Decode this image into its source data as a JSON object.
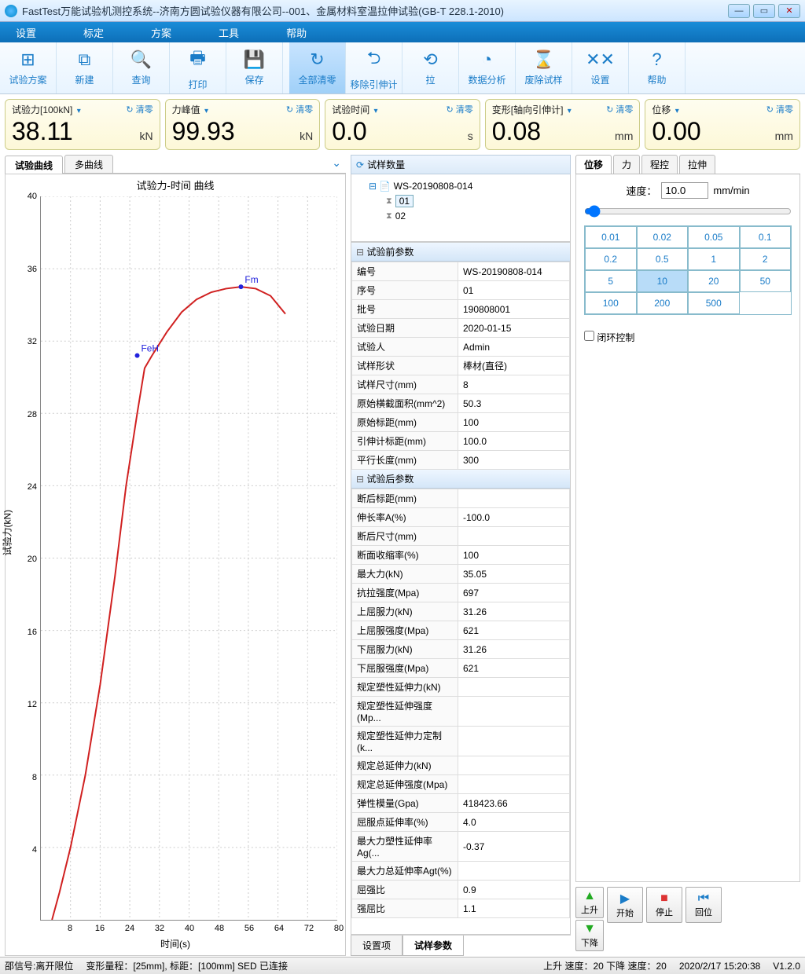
{
  "window": {
    "title": "FastTest万能试验机测控系统--济南方圆试验仪器有限公司--001、金属材料室温拉伸试验(GB-T 228.1-2010)"
  },
  "menu": {
    "items": [
      "设置",
      "标定",
      "方案",
      "工具",
      "帮助"
    ]
  },
  "toolbar": {
    "items": [
      {
        "label": "试验方案",
        "icon": "⊞"
      },
      {
        "label": "新建",
        "icon": "⧉"
      },
      {
        "label": "查询",
        "icon": "🔍"
      },
      {
        "label": "打印",
        "icon": "🖶"
      },
      {
        "label": "保存",
        "icon": "💾"
      },
      {
        "label": "全部清零",
        "icon": "↻",
        "active": true
      },
      {
        "label": "移除引伸计",
        "icon": "⮌"
      },
      {
        "label": "拉",
        "icon": "⟲"
      },
      {
        "label": "数据分析",
        "icon": "◔"
      },
      {
        "label": "废除试样",
        "icon": "⌛"
      },
      {
        "label": "设置",
        "icon": "✕✕"
      },
      {
        "label": "帮助",
        "icon": "?"
      }
    ]
  },
  "readouts": [
    {
      "label": "试验力[100kN]",
      "value": "38.11",
      "unit": "kN",
      "zero": "清零"
    },
    {
      "label": "力峰值",
      "value": "99.93",
      "unit": "kN",
      "zero": "清零"
    },
    {
      "label": "试验时间",
      "value": "0.0",
      "unit": "s",
      "zero": "清零"
    },
    {
      "label": "变形[轴向引伸计]",
      "value": "0.08",
      "unit": "mm",
      "zero": "清零"
    },
    {
      "label": "位移",
      "value": "0.00",
      "unit": "mm",
      "zero": "清零"
    }
  ],
  "curve_tabs": {
    "items": [
      "试验曲线",
      "多曲线"
    ],
    "active": 0
  },
  "chart_data": {
    "type": "line",
    "title": "试验力-时间 曲线",
    "xlabel": "时间(s)",
    "ylabel": "试验力(kN)",
    "xlim": [
      0,
      80
    ],
    "ylim": [
      0,
      40
    ],
    "xticks": [
      8,
      16,
      24,
      32,
      40,
      48,
      56,
      64,
      72,
      80
    ],
    "yticks": [
      4,
      8,
      12,
      16,
      20,
      24,
      28,
      32,
      36,
      40
    ],
    "series": [
      {
        "name": "curve",
        "color": "#d02020",
        "x": [
          3,
          5,
          8,
          12,
          16,
          20,
          23,
          26,
          28,
          30,
          34,
          38,
          42,
          46,
          50,
          54,
          58,
          62,
          64,
          66
        ],
        "y": [
          0,
          1.5,
          4,
          8,
          13,
          19,
          24,
          28,
          30.5,
          31.2,
          32.5,
          33.6,
          34.3,
          34.7,
          34.9,
          35.0,
          34.9,
          34.5,
          34.0,
          33.5
        ]
      }
    ],
    "annotations": [
      {
        "label": "FeH",
        "x": 26,
        "y": 31.2
      },
      {
        "label": "Fm",
        "x": 54,
        "y": 35.0
      }
    ]
  },
  "tree": {
    "header": "试样数量",
    "root": "WS-20190808-014",
    "leaves": [
      {
        "id": "01",
        "sel": true
      },
      {
        "id": "02",
        "sel": false
      }
    ]
  },
  "params": {
    "pre_header": "试验前参数",
    "post_header": "试验后参数",
    "pre": [
      {
        "k": "编号",
        "v": "WS-20190808-014"
      },
      {
        "k": "序号",
        "v": "01"
      },
      {
        "k": "批号",
        "v": "190808001"
      },
      {
        "k": "试验日期",
        "v": "2020-01-15"
      },
      {
        "k": "试验人",
        "v": "Admin"
      },
      {
        "k": "试样形状",
        "v": "棒材(直径)"
      },
      {
        "k": "试样尺寸(mm)",
        "v": "8"
      },
      {
        "k": "原始横截面积(mm^2)",
        "v": "50.3"
      },
      {
        "k": "原始标距(mm)",
        "v": "100"
      },
      {
        "k": "引伸计标距(mm)",
        "v": "100.0"
      },
      {
        "k": "平行长度(mm)",
        "v": "300"
      }
    ],
    "post": [
      {
        "k": "断后标距(mm)",
        "v": ""
      },
      {
        "k": "伸长率A(%)",
        "v": "-100.0"
      },
      {
        "k": "断后尺寸(mm)",
        "v": ""
      },
      {
        "k": "断面收缩率(%)",
        "v": "100"
      },
      {
        "k": "最大力(kN)",
        "v": "35.05"
      },
      {
        "k": "抗拉强度(Mpa)",
        "v": "697"
      },
      {
        "k": "上屈服力(kN)",
        "v": "31.26"
      },
      {
        "k": "上屈服强度(Mpa)",
        "v": "621"
      },
      {
        "k": "下屈服力(kN)",
        "v": "31.26"
      },
      {
        "k": "下屈服强度(Mpa)",
        "v": "621"
      },
      {
        "k": "规定塑性延伸力(kN)",
        "v": ""
      },
      {
        "k": "规定塑性延伸强度(Mp...",
        "v": ""
      },
      {
        "k": "规定塑性延伸力定制(k...",
        "v": ""
      },
      {
        "k": "规定总延伸力(kN)",
        "v": ""
      },
      {
        "k": "规定总延伸强度(Mpa)",
        "v": ""
      },
      {
        "k": "弹性模量(Gpa)",
        "v": "418423.66"
      },
      {
        "k": "屈服点延伸率(%)",
        "v": "4.0"
      },
      {
        "k": "最大力塑性延伸率Ag(...",
        "v": "-0.37"
      },
      {
        "k": "最大力总延伸率Agt(%)",
        "v": ""
      },
      {
        "k": "屈强比",
        "v": "0.9"
      },
      {
        "k": "强屈比",
        "v": "1.1"
      }
    ]
  },
  "bottom_tabs": {
    "items": [
      "设置项",
      "试样参数"
    ],
    "active": 1
  },
  "right_tabs": {
    "items": [
      "位移",
      "力",
      "程控",
      "拉伸"
    ],
    "active": 0
  },
  "speed": {
    "label": "速度：",
    "value": "10.0",
    "unit": "mm/min"
  },
  "speed_buttons": [
    "0.01",
    "0.02",
    "0.05",
    "0.1",
    "0.2",
    "0.5",
    "1",
    "2",
    "5",
    "10",
    "20",
    "50",
    "100",
    "200",
    "500"
  ],
  "speed_selected": "10",
  "closed_loop": "闭环控制",
  "ctrl": {
    "up": "上升",
    "down": "下降",
    "start": "开始",
    "stop": "停止",
    "return": "回位"
  },
  "status": {
    "sig": "邵信号:离开限位",
    "deform": "变形量程：[25mm], 标距：[100mm]  SED 已连接",
    "dir": "上升 速度：20 下降 速度：20",
    "time": "2020/2/17 15:20:38",
    "ver": "V1.2.0"
  }
}
